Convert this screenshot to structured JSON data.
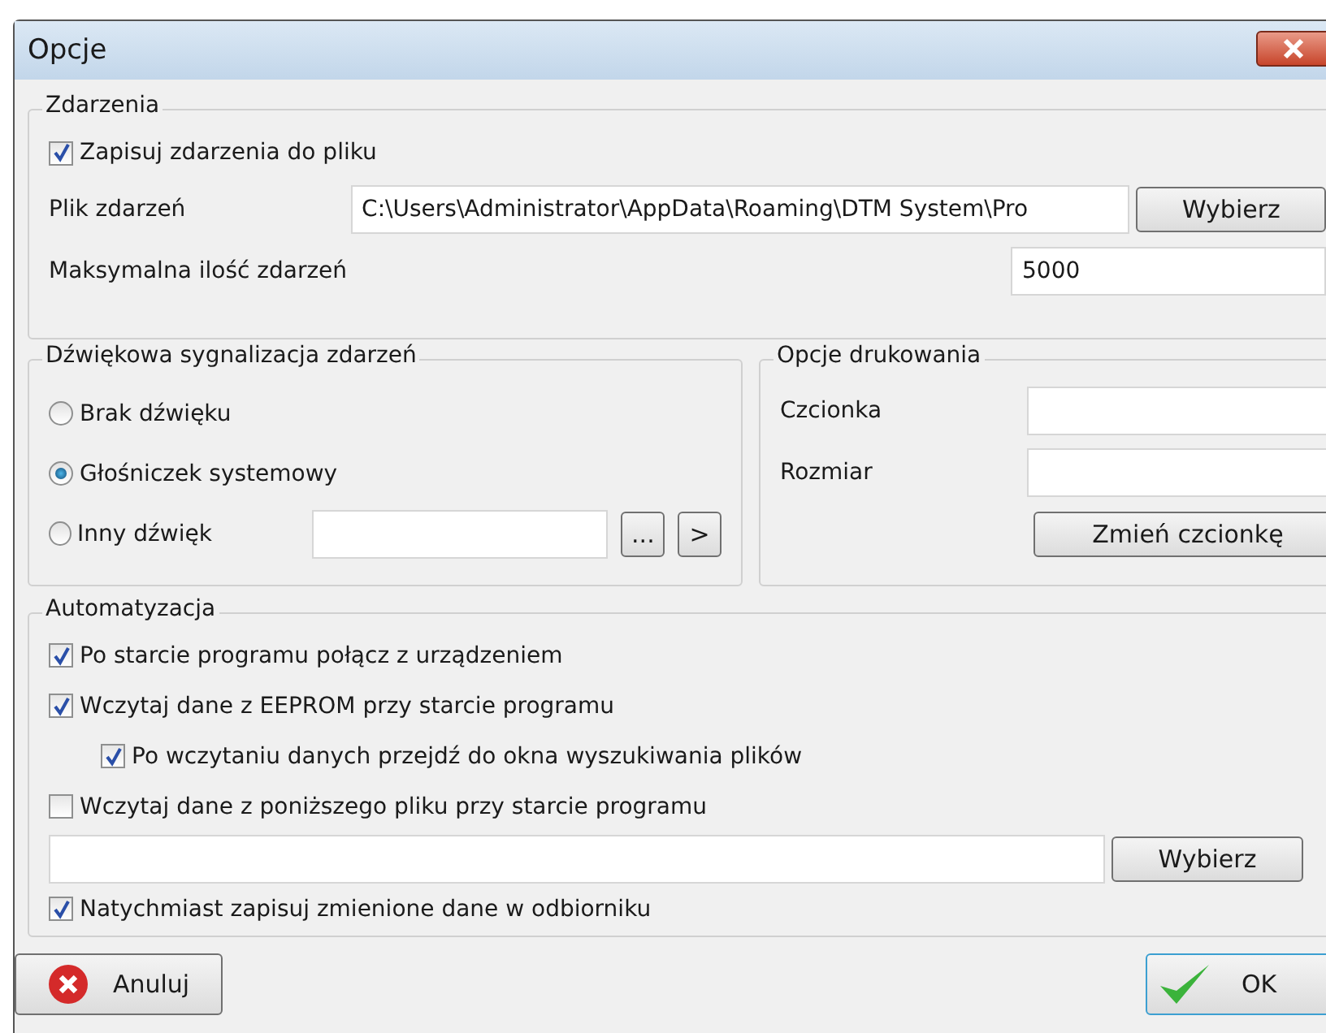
{
  "window": {
    "title": "Opcje"
  },
  "events": {
    "title": "Zdarzenia",
    "save_to_file": {
      "label": "Zapisuj zdarzenia do pliku",
      "checked": true
    },
    "file": {
      "label": "Plik zdarzeń",
      "value": "C:\\Users\\Administrator\\AppData\\Roaming\\DTM System\\Pro",
      "button": "Wybierz"
    },
    "max": {
      "label": "Maksymalna ilość zdarzeń",
      "value": "5000"
    }
  },
  "sound": {
    "title": "Dźwiękowa sygnalizacja zdarzeń",
    "options": [
      {
        "label": "Brak dźwięku",
        "selected": false
      },
      {
        "label": "Głośniczek systemowy",
        "selected": true
      },
      {
        "label": "Inny dźwięk",
        "selected": false
      }
    ],
    "browse_button": "...",
    "play_button": ">"
  },
  "printing": {
    "title": "Opcje drukowania",
    "font_label": "Czcionka",
    "size_label": "Rozmiar",
    "button": "Zmień czcionkę"
  },
  "automation": {
    "title": "Automatyzacja",
    "items": [
      {
        "label": "Po starcie programu połącz z urządzeniem",
        "checked": true
      },
      {
        "label": "Wczytaj dane z EEPROM przy starcie programu",
        "checked": true,
        "children": [
          {
            "label": "Po wczytaniu danych przejdź do okna wyszukiwania plików",
            "checked": true
          }
        ]
      },
      {
        "label": "Wczytaj dane z poniższego pliku przy starcie programu",
        "checked": false
      }
    ],
    "file_button": "Wybierz",
    "last": {
      "label": "Natychmiast zapisuj zmienione dane w odbiorniku",
      "checked": true
    }
  },
  "buttons": {
    "cancel": "Anuluj",
    "ok": "OK"
  }
}
